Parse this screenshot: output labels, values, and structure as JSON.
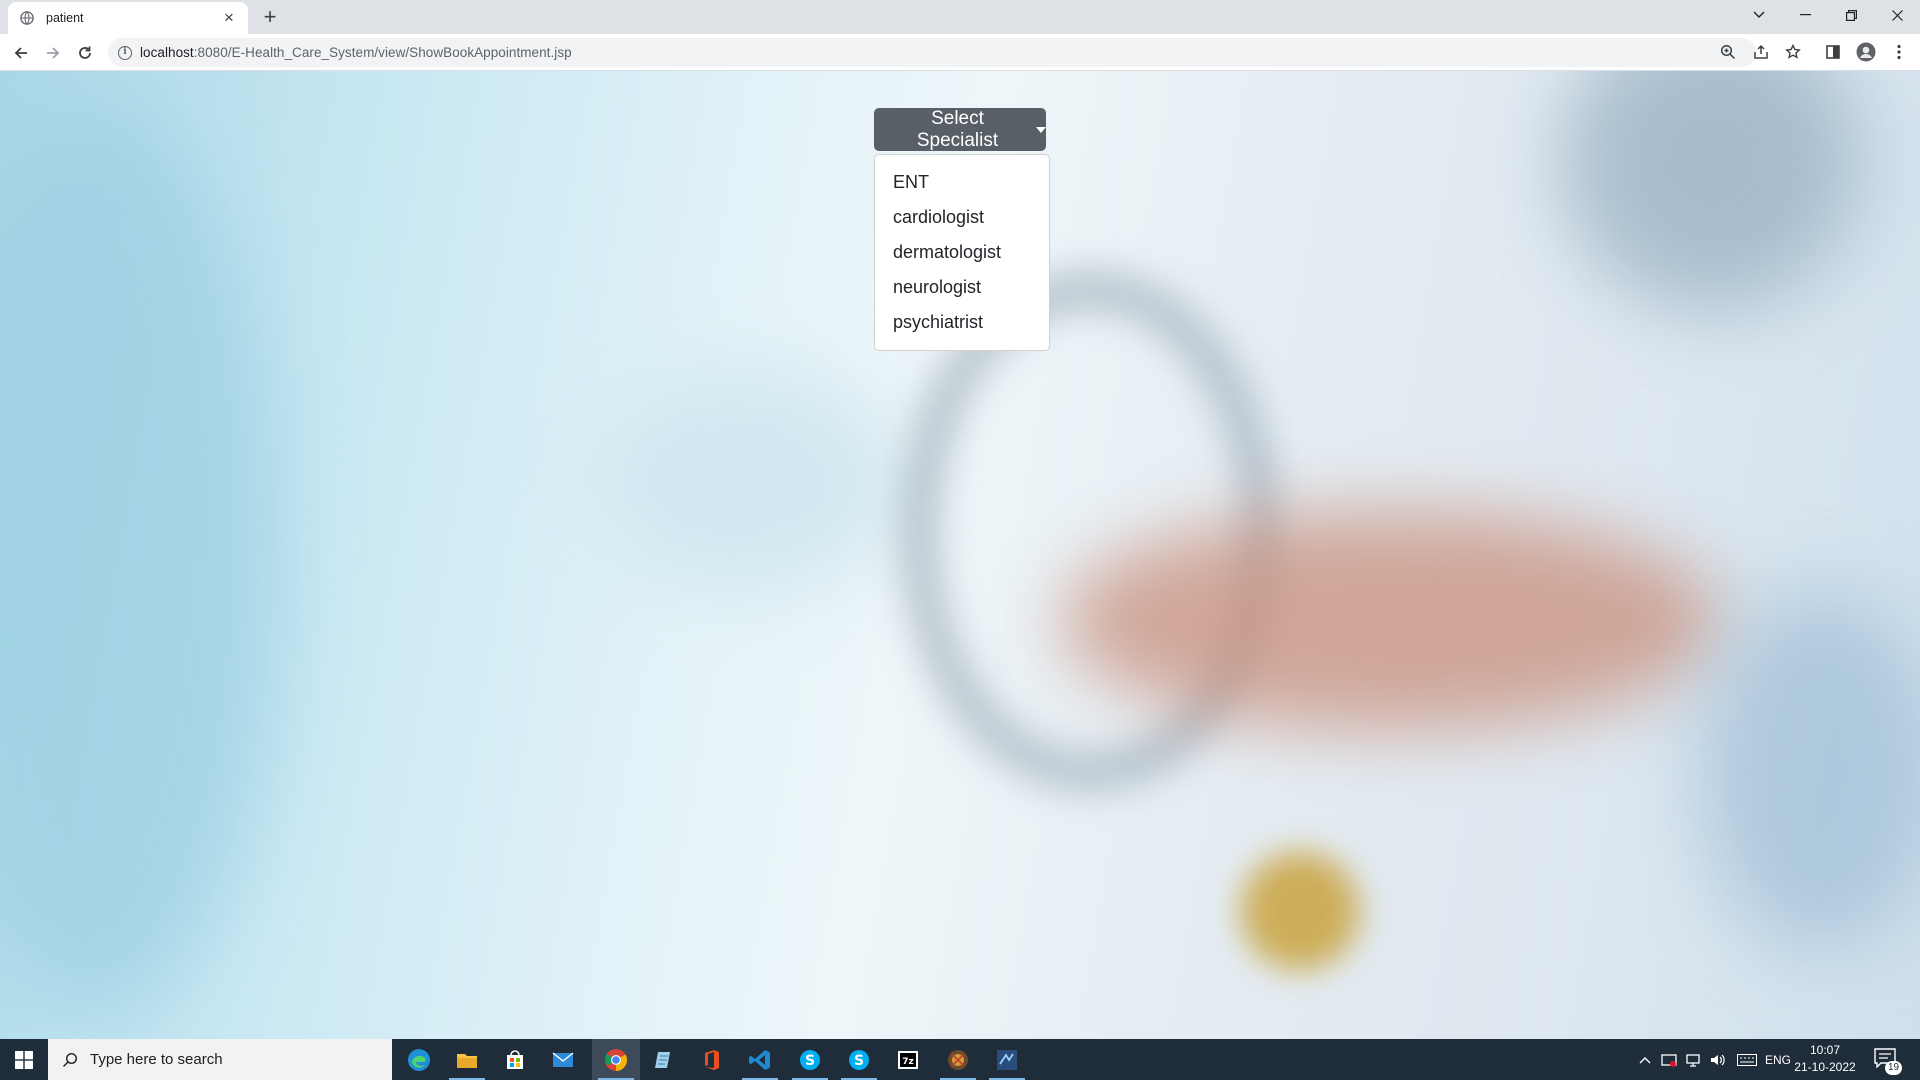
{
  "browser": {
    "tab_title": "patient",
    "url_host": "localhost",
    "url_path": ":8080/E-Health_Care_System/view/ShowBookAppointment.jsp"
  },
  "page": {
    "dropdown": {
      "toggle_label": "Select Specialist",
      "items": [
        "ENT",
        "cardiologist",
        "dermatologist",
        "neurologist",
        "psychiatrist"
      ]
    }
  },
  "taskbar": {
    "search_placeholder": "Type here to search",
    "language": "ENG",
    "time": "10:07",
    "date": "21-10-2022",
    "notification_count": "19"
  },
  "colors": {
    "toggle_bg": "#595f66",
    "taskbar_bg": "#1f2c3a"
  },
  "icons": [
    "globe-icon",
    "close-icon",
    "plus-icon",
    "back-icon",
    "forward-icon",
    "reload-icon",
    "info-icon",
    "zoom-icon",
    "share-icon",
    "star-icon",
    "sidebar-icon",
    "profile-icon",
    "menu-icon",
    "windows-icon",
    "search-icon",
    "edge-icon",
    "file-explorer-icon",
    "store-icon",
    "mail-icon",
    "chrome-icon",
    "notepad-icon",
    "office-icon",
    "vscode-icon",
    "skype-icon",
    "7zip-icon",
    "game-icon",
    "vs-icon",
    "chevron-up-icon",
    "network-icon",
    "volume-icon",
    "keyboard-icon",
    "notification-icon"
  ]
}
